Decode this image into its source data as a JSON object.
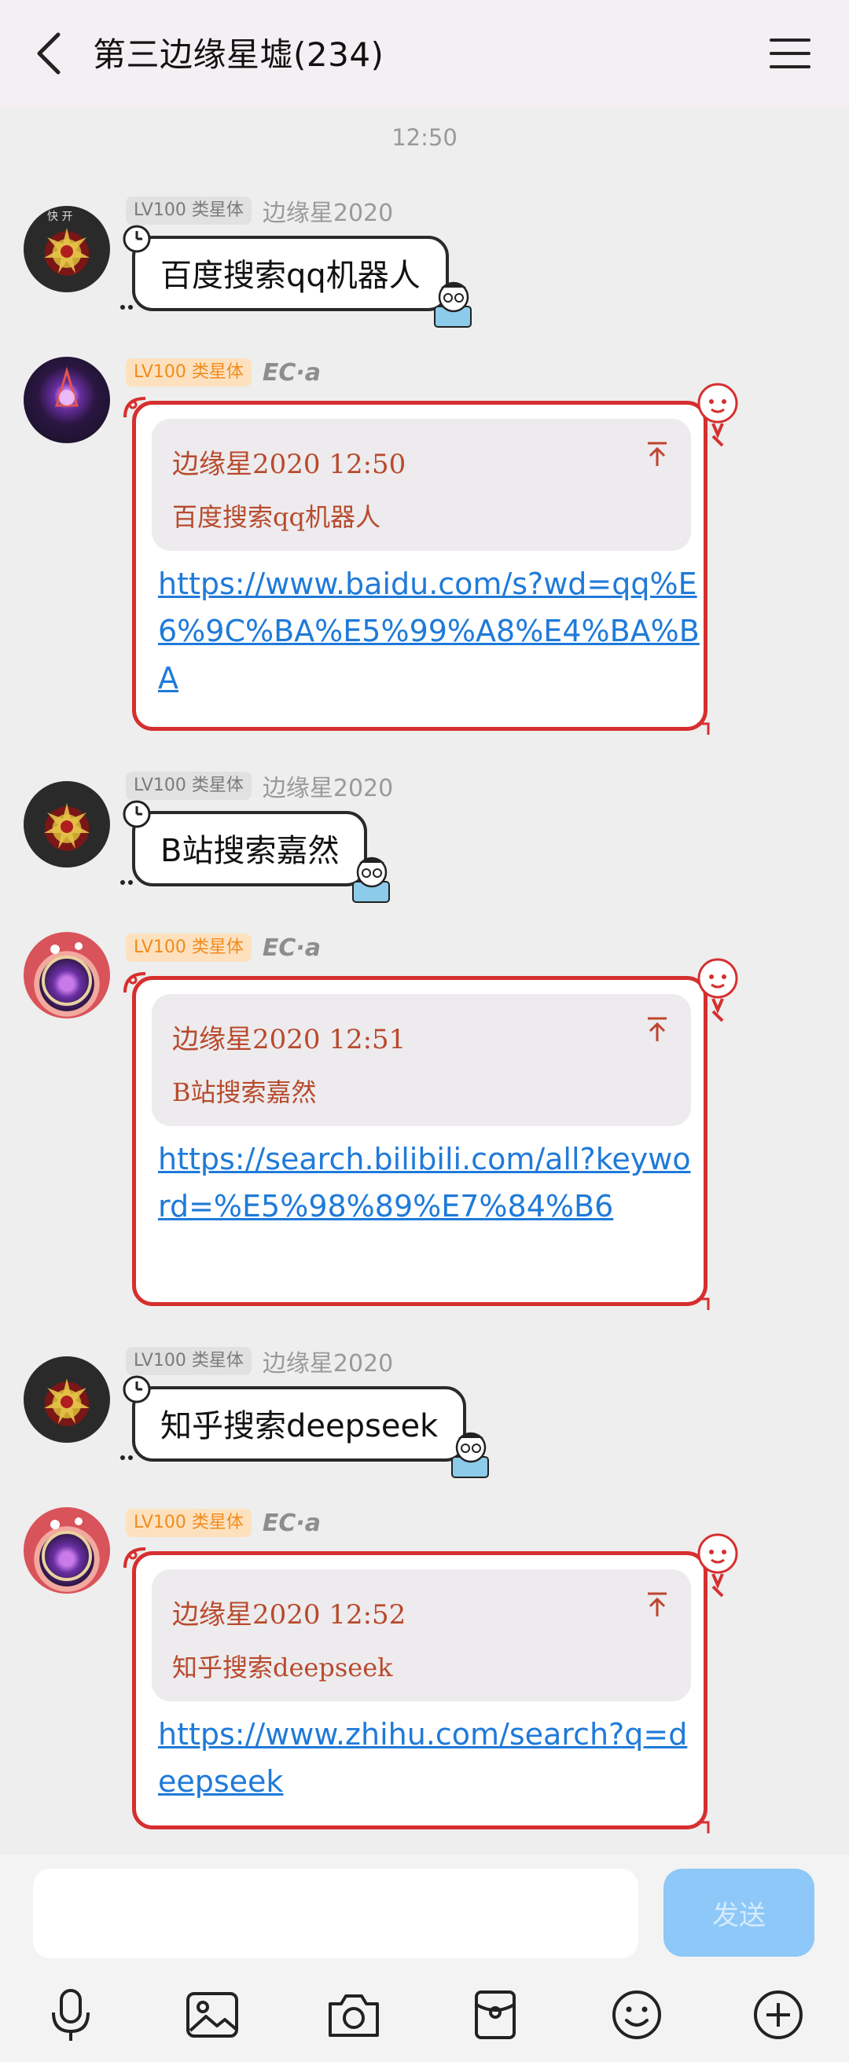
{
  "header": {
    "title": "第三边缘星墟(234)"
  },
  "chat": {
    "timestamp": "12:50",
    "messages": [
      {
        "type": "text",
        "level": "LV100 类星体",
        "nickname": "边缘星2020",
        "text": "百度搜索qq机器人"
      },
      {
        "type": "reply",
        "level": "LV100 类星体",
        "nickname": "EC·a",
        "quote_header": "边缘星2020 12:50",
        "quote_text": "百度搜索qq机器人",
        "link": "https://www.baidu.com/s?wd=qq%E6%9C%BA%E5%99%A8%E4%BA%BA"
      },
      {
        "type": "text",
        "level": "LV100 类星体",
        "nickname": "边缘星2020",
        "text": "B站搜索嘉然"
      },
      {
        "type": "reply",
        "level": "LV100 类星体",
        "nickname": "EC·a",
        "quote_header": "边缘星2020 12:51",
        "quote_text": "B站搜索嘉然",
        "link": "https://search.bilibili.com/all?keyword=%E5%98%89%E7%84%B6"
      },
      {
        "type": "text",
        "level": "LV100 类星体",
        "nickname": "边缘星2020",
        "text": "知乎搜索deepseek"
      },
      {
        "type": "reply",
        "level": "LV100 类星体",
        "nickname": "EC·a",
        "quote_header": "边缘星2020 12:52",
        "quote_text": "知乎搜索deepseek",
        "link": "https://www.zhihu.com/search?q=deepseek"
      }
    ]
  },
  "input": {
    "send_label": "发送",
    "toolbar_icons": [
      "microphone-icon",
      "image-icon",
      "camera-icon",
      "red-packet-icon",
      "emoji-icon",
      "plus-icon"
    ]
  },
  "colors": {
    "header_bg": "#f4eff3",
    "chat_bg": "#edeeed",
    "card_border": "#d62f2f",
    "link": "#1f7ad9",
    "quote_text": "#b84a2d",
    "send_button": "#8dc8f8",
    "level_orange": "#f08b1d"
  }
}
